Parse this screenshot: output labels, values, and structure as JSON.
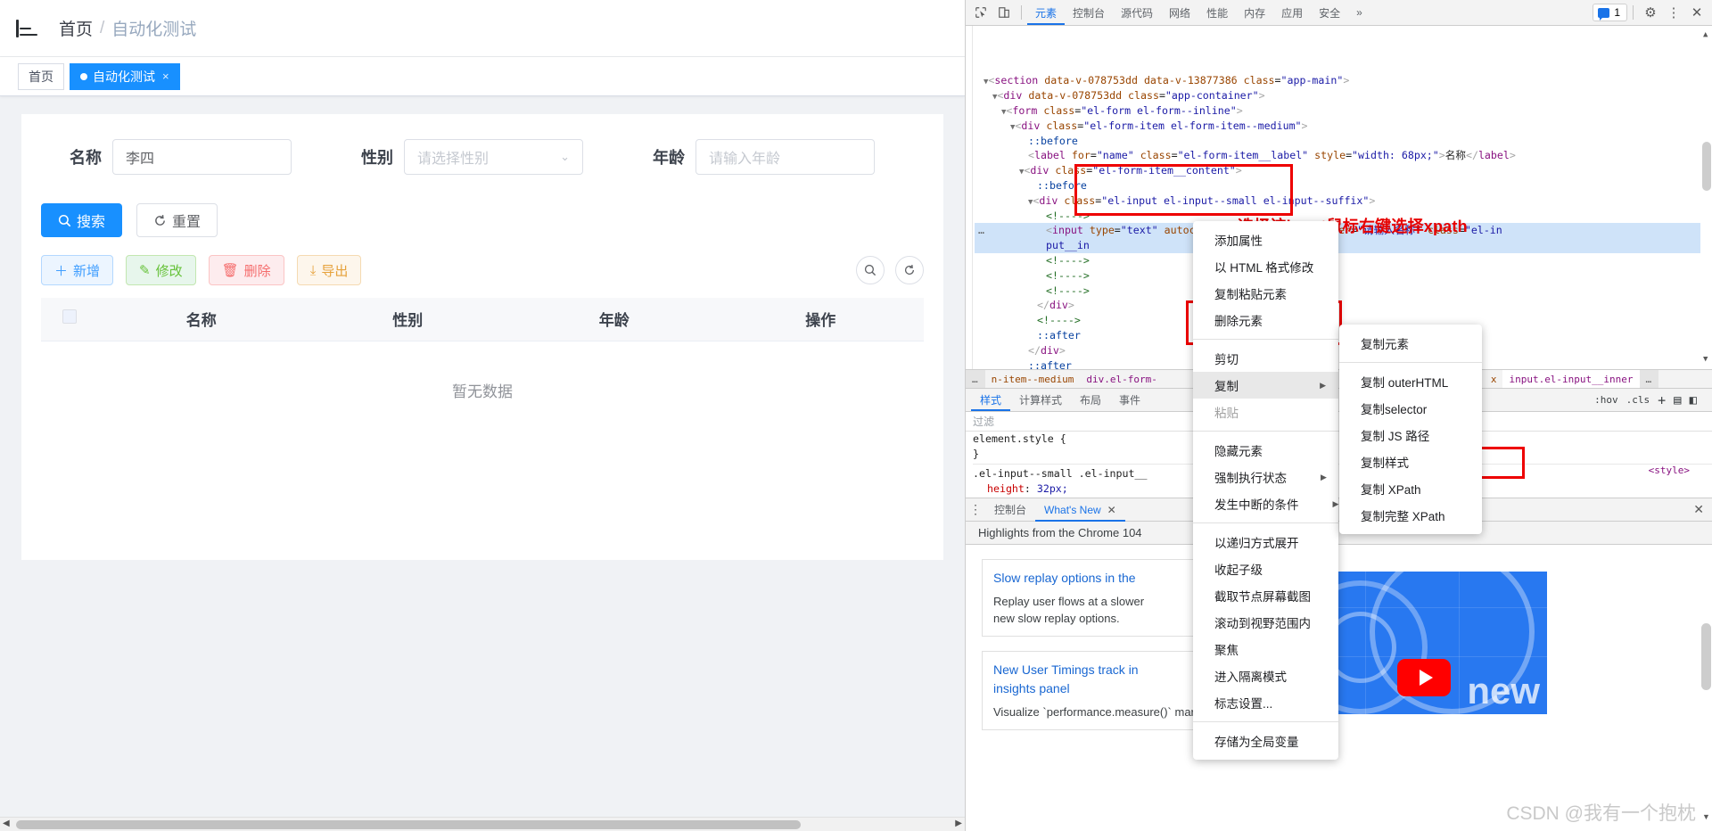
{
  "app": {
    "breadcrumb": {
      "home": "首页",
      "separator": "/",
      "current": "自动化测试"
    },
    "tabs": [
      {
        "label": "首页",
        "active": false,
        "closable": false
      },
      {
        "label": "自动化测试",
        "active": true,
        "closable": true,
        "close": "×"
      }
    ],
    "filters": {
      "name": {
        "label": "名称",
        "value": "李四"
      },
      "gender": {
        "label": "性别",
        "placeholder": "请选择性别",
        "caret": "⌄"
      },
      "age": {
        "label": "年龄",
        "placeholder": "请输入年龄"
      }
    },
    "actions": {
      "search": {
        "label": "搜索",
        "icon": "search-icon"
      },
      "reset": {
        "label": "重置",
        "icon": "refresh-icon"
      }
    },
    "toolbar": [
      {
        "label": "新增",
        "icon": "plus-icon",
        "style": "add"
      },
      {
        "label": "修改",
        "icon": "pencil-icon",
        "style": "edit"
      },
      {
        "label": "删除",
        "icon": "trash-icon",
        "style": "delete"
      },
      {
        "label": "导出",
        "icon": "download-icon",
        "style": "export"
      }
    ],
    "right_tools": [
      {
        "icon": "search-circle-icon"
      },
      {
        "icon": "refresh-circle-icon"
      }
    ],
    "table": {
      "columns": [
        "",
        "名称",
        "性别",
        "年龄",
        "操作"
      ],
      "rows": [],
      "empty_text": "暂无数据"
    }
  },
  "devtools": {
    "tabs": [
      {
        "label": "元素",
        "active": true
      },
      {
        "label": "控制台",
        "active": false
      },
      {
        "label": "源代码",
        "active": false
      },
      {
        "label": "网络",
        "active": false
      },
      {
        "label": "性能",
        "active": false
      },
      {
        "label": "内存",
        "active": false
      },
      {
        "label": "应用",
        "active": false
      },
      {
        "label": "安全",
        "active": false
      }
    ],
    "overflow": "»",
    "issues_count": "1",
    "icons": {
      "inspect": "inspect-cursor-icon",
      "device": "device-toolbar-icon",
      "issues": "issues-chat-icon",
      "settings": "gear-icon",
      "more": "kebab-menu-icon",
      "close": "close-icon"
    },
    "dom_lines": [
      {
        "indent": 1,
        "html": "<span class='tri'>▼</span><span class='pk'>&lt;</span><span class='tg'>section</span> <span class='at'>data-v-078753dd</span> <span class='at'>data-v-13877386</span> <span class='at'>class</span>=<span class='vl'>\"app-main\"</span><span class='pk'>&gt;</span>"
      },
      {
        "indent": 2,
        "html": "<span class='tri'>▼</span><span class='pk'>&lt;</span><span class='tg'>div</span> <span class='at'>data-v-078753dd</span> <span class='at'>class</span>=<span class='vl'>\"app-container\"</span><span class='pk'>&gt;</span>"
      },
      {
        "indent": 3,
        "html": "<span class='tri'>▼</span><span class='pk'>&lt;</span><span class='tg'>form</span> <span class='at'>class</span>=<span class='vl'>\"el-form el-form--inline\"</span><span class='pk'>&gt;</span>"
      },
      {
        "indent": 4,
        "html": "<span class='tri'>▼</span><span class='pk'>&lt;</span><span class='tg'>div</span> <span class='at'>class</span>=<span class='vl'>\"el-form-item el-form-item--medium\"</span><span class='pk'>&gt;</span>"
      },
      {
        "indent": 6,
        "html": "<span class='pseudo'>::before</span>"
      },
      {
        "indent": 6,
        "html": "<span class='pk'>&lt;</span><span class='tg'>label</span> <span class='at'>for</span>=<span class='vl'>\"name\"</span> <span class='at'>class</span>=<span class='vl'>\"el-form-item__label\"</span> <span class='at'>style</span>=<span class='vl'>\"width: 68px;\"</span><span class='pk'>&gt;</span>名称<span class='pk'>&lt;/</span><span class='tg'>label</span><span class='pk'>&gt;</span>"
      },
      {
        "indent": 5,
        "html": "<span class='tri'>▼</span><span class='pk'>&lt;</span><span class='tg'>div</span> <span class='at'>class</span>=<span class='vl'>\"el-form-item__content\"</span><span class='pk'>&gt;</span>"
      },
      {
        "indent": 7,
        "html": "<span class='pseudo'>::before</span>"
      },
      {
        "indent": 6,
        "html": "<span class='tri'>▼</span><span class='pk'>&lt;</span><span class='tg'>div</span> <span class='at'>class</span>=<span class='vl'>\"el-input el-input--small el-input--suffix\"</span><span class='pk'>&gt;</span>"
      },
      {
        "indent": 8,
        "html": "<span class='cmt'>&lt;!----&gt;</span>"
      },
      {
        "indent": 8,
        "html": "<span class='pk'>&lt;</span><span class='tg'>input</span> <span class='at'>type</span>=<span class='vl'>\"text\"</span> <span class='at'>autocomplete</span>=<span class='vl'>\"off\"</span> <span class='at'>placeholder</span>=<span class='vl'>\"请输入名称\"</span> <span class='at'>class</span>=<span class='vl'>\"el-in</span>",
        "selected": true
      },
      {
        "indent": 8,
        "html": "<span class='vl'>put__in</span>",
        "selected": true
      },
      {
        "indent": 8,
        "html": "<span class='cmt'>&lt;!----&gt;</span>"
      },
      {
        "indent": 8,
        "html": "<span class='cmt'>&lt;!----&gt;</span>"
      },
      {
        "indent": 8,
        "html": "<span class='cmt'>&lt;!----&gt;</span>"
      },
      {
        "indent": 7,
        "html": "<span class='pk'>&lt;/</span><span class='tg'>div</span><span class='pk'>&gt;</span>"
      },
      {
        "indent": 7,
        "html": "<span class='cmt'>&lt;!----&gt;</span>"
      },
      {
        "indent": 7,
        "html": "<span class='pseudo'>::after</span>"
      },
      {
        "indent": 6,
        "html": "<span class='pk'>&lt;/</span><span class='tg'>div</span><span class='pk'>&gt;</span>"
      },
      {
        "indent": 6,
        "html": "<span class='pseudo'>::after</span>"
      },
      {
        "indent": 5,
        "html": "<span class='pk'>&lt;/</span><span class='tg'>div</span><span class='pk'>&gt;</span>"
      }
    ],
    "annotation": "选择该input鼠标右键选择xpath",
    "breadcrumb": [
      "…",
      "n-item--medium",
      "div.el-form-",
      "x",
      "input.el-input__inner",
      "…"
    ],
    "styles_tabs": [
      {
        "label": "样式",
        "active": true
      },
      {
        "label": "计算样式",
        "active": false
      },
      {
        "label": "布局",
        "active": false
      },
      {
        "label": "事件",
        "active": false
      }
    ],
    "styles_tools": [
      ":hov",
      ".cls",
      "+",
      "▤",
      "◧"
    ],
    "styles_filter_placeholder": "过滤",
    "styles_rules": [
      {
        "selector": "element.style {",
        "close": "}"
      },
      {
        "selector": ".el-input--small .el-input__",
        "prop": "height",
        "value": "32px;"
      }
    ],
    "styles_source": "<style>",
    "drawer_tabs": [
      {
        "label": "控制台",
        "active": false
      },
      {
        "label": "What's New",
        "active": true,
        "close": "✕"
      }
    ],
    "whats_new_header": "Highlights from the Chrome 104",
    "whats_new_items": [
      {
        "title": "Slow replay options in the",
        "desc": "Replay user flows at a slower\nnew slow replay options."
      },
      {
        "title": "New User Timings track in\ninsights panel",
        "desc": "Visualize `performance.measure()` marks in the"
      }
    ],
    "thumb_text": "new",
    "context_menu": [
      {
        "label": "添加属性"
      },
      {
        "label": "以 HTML 格式修改"
      },
      {
        "label": "复制粘贴元素"
      },
      {
        "label": "删除元素"
      },
      {
        "divider": true
      },
      {
        "label": "剪切"
      },
      {
        "label": "复制",
        "submenu": true,
        "highlighted": true,
        "arrow": "▶"
      },
      {
        "label": "粘贴",
        "disabled": true
      },
      {
        "divider": true
      },
      {
        "label": "隐藏元素"
      },
      {
        "label": "强制执行状态",
        "submenu": true,
        "arrow": "▶"
      },
      {
        "label": "发生中断的条件",
        "submenu": true,
        "arrow": "▶"
      },
      {
        "divider": true
      },
      {
        "label": "以递归方式展开"
      },
      {
        "label": "收起子级"
      },
      {
        "label": "截取节点屏幕截图"
      },
      {
        "label": "滚动到视野范围内"
      },
      {
        "label": "聚焦"
      },
      {
        "label": "进入隔离模式"
      },
      {
        "label": "标志设置..."
      },
      {
        "divider": true
      },
      {
        "label": "存储为全局变量"
      }
    ],
    "copy_submenu": [
      {
        "label": "复制元素"
      },
      {
        "divider": true
      },
      {
        "label": "复制 outerHTML"
      },
      {
        "label": "复制selector"
      },
      {
        "label": "复制 JS 路径"
      },
      {
        "label": "复制样式"
      },
      {
        "label": "复制 XPath",
        "boxed": true
      },
      {
        "label": "复制完整 XPath"
      }
    ]
  },
  "watermark": "CSDN @我有一个抱枕"
}
